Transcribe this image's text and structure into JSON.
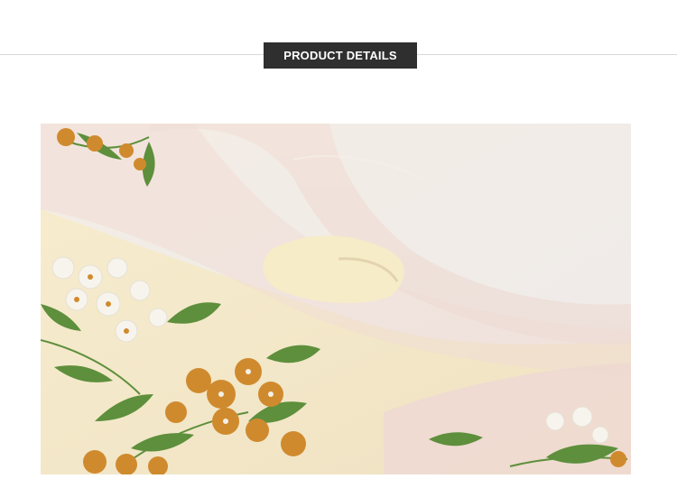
{
  "section": {
    "title": "PRODUCT DETAILS"
  },
  "photo": {
    "subject": "embroidered-tulle-dress-closeup-icon"
  },
  "colors": {
    "badge_bg": "#2f2f2f",
    "badge_text": "#ffffff",
    "divider": "#d9d9d9"
  }
}
